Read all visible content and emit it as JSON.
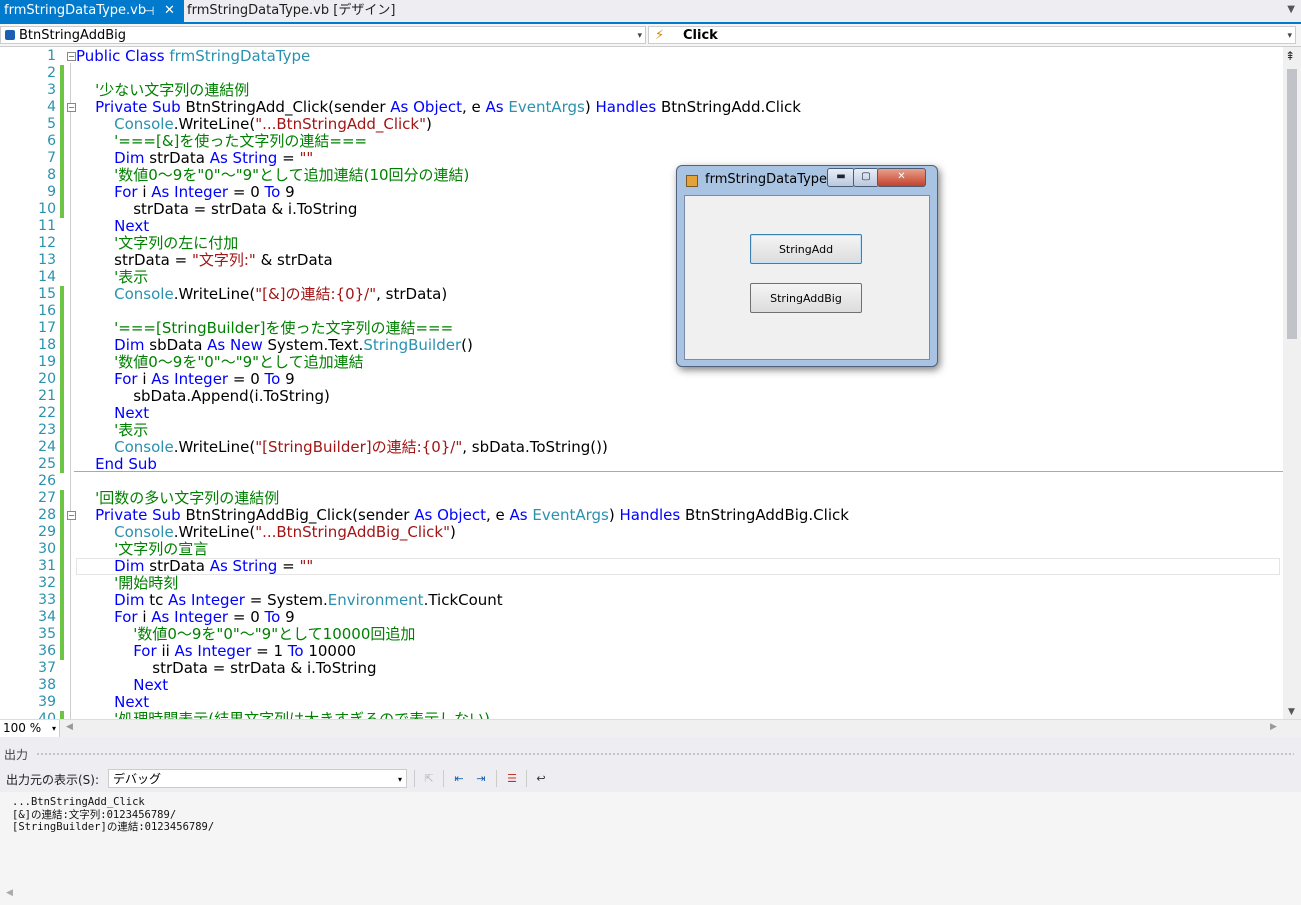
{
  "tabs": {
    "active": {
      "label": "frmStringDataType.vb",
      "pin": "⊣",
      "close": "✕"
    },
    "other": {
      "label": "frmStringDataType.vb [デザイン]"
    },
    "dropdown": "▼"
  },
  "navbar": {
    "class_combo": "BtnStringAddBig",
    "method_combo": "Click",
    "method_icon": "⚡",
    "arrow": "▾"
  },
  "editor": {
    "zoom": "100 %",
    "zoom_arrow": "▾",
    "lines": [
      {
        "n": "1",
        "chg": false,
        "fold": "⊟",
        "t": [
          [
            "kw",
            "Public Class "
          ],
          [
            "typ",
            "frmStringDataType"
          ]
        ]
      },
      {
        "n": "2",
        "chg": true,
        "t": []
      },
      {
        "n": "3",
        "chg": true,
        "t": [
          [
            "cmt",
            "    '少ない文字列の連結例"
          ]
        ]
      },
      {
        "n": "4",
        "chg": true,
        "fold": "⊟",
        "t": [
          [
            "kw",
            "    Private Sub "
          ],
          [
            "",
            "BtnStringAdd_Click(sender "
          ],
          [
            "kw",
            "As Object"
          ],
          [
            "",
            ", e "
          ],
          [
            "kw",
            "As "
          ],
          [
            "typ",
            "EventArgs"
          ],
          [
            "",
            ") "
          ],
          [
            "kw",
            "Handles "
          ],
          [
            "",
            "BtnStringAdd.Click"
          ]
        ]
      },
      {
        "n": "5",
        "chg": true,
        "t": [
          [
            "typ",
            "        Console"
          ],
          [
            "",
            ".WriteLine("
          ],
          [
            "str",
            "\"...BtnStringAdd_Click\""
          ],
          [
            "",
            ")"
          ]
        ]
      },
      {
        "n": "6",
        "chg": true,
        "t": [
          [
            "cmt",
            "        '===[&]を使った文字列の連結==="
          ]
        ]
      },
      {
        "n": "7",
        "chg": true,
        "t": [
          [
            "kw",
            "        Dim "
          ],
          [
            "",
            "strData "
          ],
          [
            "kw",
            "As String "
          ],
          [
            "",
            "= "
          ],
          [
            "str",
            "\"\""
          ]
        ]
      },
      {
        "n": "8",
        "chg": true,
        "t": [
          [
            "cmt",
            "        '数値0～9を\"0\"～\"9\"として追加連結(10回分の連結)"
          ]
        ]
      },
      {
        "n": "9",
        "chg": true,
        "t": [
          [
            "kw",
            "        For "
          ],
          [
            "",
            "i "
          ],
          [
            "kw",
            "As Integer "
          ],
          [
            "",
            "= 0 "
          ],
          [
            "kw",
            "To "
          ],
          [
            "",
            "9"
          ]
        ]
      },
      {
        "n": "10",
        "chg": true,
        "t": [
          [
            "",
            "            strData = strData & i.ToString"
          ]
        ]
      },
      {
        "n": "11",
        "chg": false,
        "t": [
          [
            "kw",
            "        Next"
          ]
        ]
      },
      {
        "n": "12",
        "chg": false,
        "t": [
          [
            "cmt",
            "        '文字列の左に付加"
          ]
        ]
      },
      {
        "n": "13",
        "chg": false,
        "t": [
          [
            "",
            "        strData = "
          ],
          [
            "str",
            "\"文字列:\""
          ],
          [
            "",
            " & strData"
          ]
        ]
      },
      {
        "n": "14",
        "chg": false,
        "t": [
          [
            "cmt",
            "        '表示"
          ]
        ]
      },
      {
        "n": "15",
        "chg": true,
        "t": [
          [
            "typ",
            "        Console"
          ],
          [
            "",
            ".WriteLine("
          ],
          [
            "str",
            "\"[&]の連結:{0}/\""
          ],
          [
            "",
            ", strData)"
          ]
        ]
      },
      {
        "n": "16",
        "chg": true,
        "t": []
      },
      {
        "n": "17",
        "chg": true,
        "t": [
          [
            "cmt",
            "        '===[StringBuilder]を使った文字列の連結==="
          ]
        ]
      },
      {
        "n": "18",
        "chg": true,
        "t": [
          [
            "kw",
            "        Dim "
          ],
          [
            "",
            "sbData "
          ],
          [
            "kw",
            "As New "
          ],
          [
            "",
            "System.Text."
          ],
          [
            "typ",
            "StringBuilder"
          ],
          [
            "",
            "()"
          ]
        ]
      },
      {
        "n": "19",
        "chg": true,
        "t": [
          [
            "cmt",
            "        '数値0～9を\"0\"～\"9\"として追加連結"
          ]
        ]
      },
      {
        "n": "20",
        "chg": true,
        "t": [
          [
            "kw",
            "        For "
          ],
          [
            "",
            "i "
          ],
          [
            "kw",
            "As Integer "
          ],
          [
            "",
            "= 0 "
          ],
          [
            "kw",
            "To "
          ],
          [
            "",
            "9"
          ]
        ]
      },
      {
        "n": "21",
        "chg": true,
        "t": [
          [
            "",
            "            sbData.Append(i.ToString)"
          ]
        ]
      },
      {
        "n": "22",
        "chg": true,
        "t": [
          [
            "kw",
            "        Next"
          ]
        ]
      },
      {
        "n": "23",
        "chg": true,
        "t": [
          [
            "cmt",
            "        '表示"
          ]
        ]
      },
      {
        "n": "24",
        "chg": true,
        "t": [
          [
            "typ",
            "        Console"
          ],
          [
            "",
            ".WriteLine("
          ],
          [
            "str",
            "\"[StringBuilder]の連結:{0}/\""
          ],
          [
            "",
            ", sbData.ToString())"
          ]
        ]
      },
      {
        "n": "25",
        "chg": true,
        "t": [
          [
            "kw",
            "    End Sub"
          ]
        ]
      },
      {
        "n": "26",
        "chg": false,
        "t": []
      },
      {
        "n": "27",
        "chg": true,
        "t": [
          [
            "cmt",
            "    '回数の多い文字列の連結例"
          ]
        ]
      },
      {
        "n": "28",
        "chg": true,
        "fold": "⊟",
        "t": [
          [
            "kw",
            "    Private Sub "
          ],
          [
            "",
            "BtnStringAddBig_Click(sender "
          ],
          [
            "kw",
            "As Object"
          ],
          [
            "",
            ", e "
          ],
          [
            "kw",
            "As "
          ],
          [
            "typ",
            "EventArgs"
          ],
          [
            "",
            ") "
          ],
          [
            "kw",
            "Handles "
          ],
          [
            "",
            "BtnStringAddBig.Click"
          ]
        ]
      },
      {
        "n": "29",
        "chg": true,
        "t": [
          [
            "typ",
            "        Console"
          ],
          [
            "",
            ".WriteLine("
          ],
          [
            "str",
            "\"...BtnStringAddBig_Click\""
          ],
          [
            "",
            ")"
          ]
        ]
      },
      {
        "n": "30",
        "chg": true,
        "t": [
          [
            "cmt",
            "        '文字列の宣言"
          ]
        ]
      },
      {
        "n": "31",
        "chg": true,
        "t": [
          [
            "kw",
            "        Dim "
          ],
          [
            "",
            "strData "
          ],
          [
            "kw",
            "As String "
          ],
          [
            "",
            "= "
          ],
          [
            "str",
            "\"\""
          ]
        ]
      },
      {
        "n": "32",
        "chg": true,
        "t": [
          [
            "cmt",
            "        '開始時刻"
          ]
        ]
      },
      {
        "n": "33",
        "chg": true,
        "t": [
          [
            "kw",
            "        Dim "
          ],
          [
            "",
            "tc "
          ],
          [
            "kw",
            "As Integer "
          ],
          [
            "",
            "= System."
          ],
          [
            "typ",
            "Environment"
          ],
          [
            "",
            ".TickCount"
          ]
        ]
      },
      {
        "n": "34",
        "chg": true,
        "t": [
          [
            "kw",
            "        For "
          ],
          [
            "",
            "i "
          ],
          [
            "kw",
            "As Integer "
          ],
          [
            "",
            "= 0 "
          ],
          [
            "kw",
            "To "
          ],
          [
            "",
            "9"
          ]
        ]
      },
      {
        "n": "35",
        "chg": true,
        "t": [
          [
            "cmt",
            "            '数値0～9を\"0\"～\"9\"として10000回追加"
          ]
        ]
      },
      {
        "n": "36",
        "chg": true,
        "t": [
          [
            "kw",
            "            For "
          ],
          [
            "",
            "ii "
          ],
          [
            "kw",
            "As Integer "
          ],
          [
            "",
            "= 1 "
          ],
          [
            "kw",
            "To "
          ],
          [
            "",
            "10000"
          ]
        ]
      },
      {
        "n": "37",
        "chg": false,
        "t": [
          [
            "",
            "                strData = strData & i.ToString"
          ]
        ]
      },
      {
        "n": "38",
        "chg": false,
        "t": [
          [
            "kw",
            "            Next"
          ]
        ]
      },
      {
        "n": "39",
        "chg": false,
        "t": [
          [
            "kw",
            "        Next"
          ]
        ]
      },
      {
        "n": "40",
        "chg": true,
        "t": [
          [
            "cmt",
            "        '処理時間表示(結果文字列は大きすぎるので表示しない)"
          ]
        ]
      }
    ]
  },
  "designer_form": {
    "title": "frmStringDataType",
    "min": "▬",
    "max": "▢",
    "close": "✕",
    "button_add": "StringAdd",
    "button_add_big": "StringAddBig"
  },
  "output": {
    "title": "出力",
    "source_label": "出力元の表示(S):",
    "source_value": "デバッグ",
    "lines": [
      "...BtnStringAdd_Click",
      "[&]の連結:文字列:0123456789/",
      "[StringBuilder]の連結:0123456789/"
    ]
  }
}
